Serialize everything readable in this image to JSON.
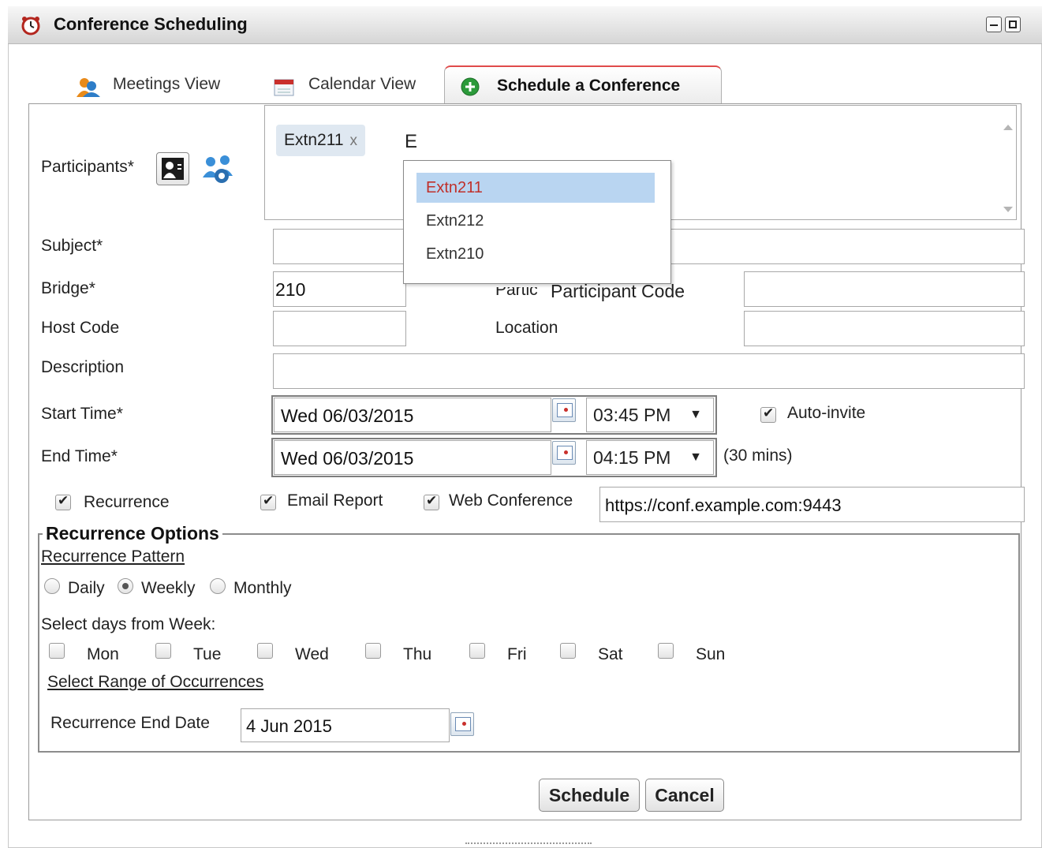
{
  "window": {
    "title": "Conference Scheduling"
  },
  "tabs": [
    {
      "label": "Meetings View",
      "icon": "users-icon"
    },
    {
      "label": "Calendar View",
      "icon": "calendar-icon"
    },
    {
      "label": "Schedule a Conference",
      "icon": "plus-circle-icon",
      "active": true
    }
  ],
  "participants": {
    "label": "Participants*",
    "selected": [
      {
        "label": "Extn211",
        "remove": "x"
      }
    ],
    "typed": "E",
    "suggestions": [
      {
        "label": "Extn211",
        "selected": true
      },
      {
        "label": "Extn212"
      },
      {
        "label": "Extn210"
      }
    ]
  },
  "form": {
    "subject_label": "Subject*",
    "subject_value": "",
    "bridge_label": "Bridge*",
    "bridge_value": "210",
    "participant_code_label_hidden": "Partic",
    "participant_code_label": "Participant Code",
    "participant_code_value": "",
    "host_code_label": "Host Code",
    "host_code_value": "",
    "location_label": "Location",
    "location_value": "",
    "description_label": "Description",
    "description_value": "",
    "start_label": "Start Time*",
    "start_date": "Wed 06/03/2015",
    "start_time": "03:45 PM",
    "end_label": "End Time*",
    "end_date": "Wed 06/03/2015",
    "end_time": "04:15 PM",
    "duration": "(30 mins)",
    "auto_invite_label": "Auto-invite",
    "auto_invite_checked": true,
    "recurrence_label": "Recurrence",
    "recurrence_checked": true,
    "email_report_label": "Email Report",
    "email_report_checked": true,
    "web_conference_label": "Web Conference",
    "web_conference_checked": true,
    "web_conference_url": "https://conf.example.com:9443",
    "caret": "▼"
  },
  "recurrence": {
    "legend": "Recurrence Options",
    "pattern_label": "Recurrence Pattern",
    "patterns": [
      {
        "label": "Daily",
        "checked": false
      },
      {
        "label": "Weekly",
        "checked": true
      },
      {
        "label": "Monthly",
        "checked": false
      }
    ],
    "days_label": "Select days from Week:",
    "days": [
      "Mon",
      "Tue",
      "Wed",
      "Thu",
      "Fri",
      "Sat",
      "Sun"
    ],
    "range_label": "Select Range of Occurrences",
    "end_date_label": "Recurrence End Date",
    "end_date_value": "4 Jun 2015"
  },
  "actions": {
    "schedule_label": "Schedule",
    "cancel_label": "Cancel"
  },
  "colors": {
    "active_tab_border": "#e04b4b",
    "suggestion_highlight": "#b9d5f1",
    "suggestion_text": "#c0302a"
  }
}
